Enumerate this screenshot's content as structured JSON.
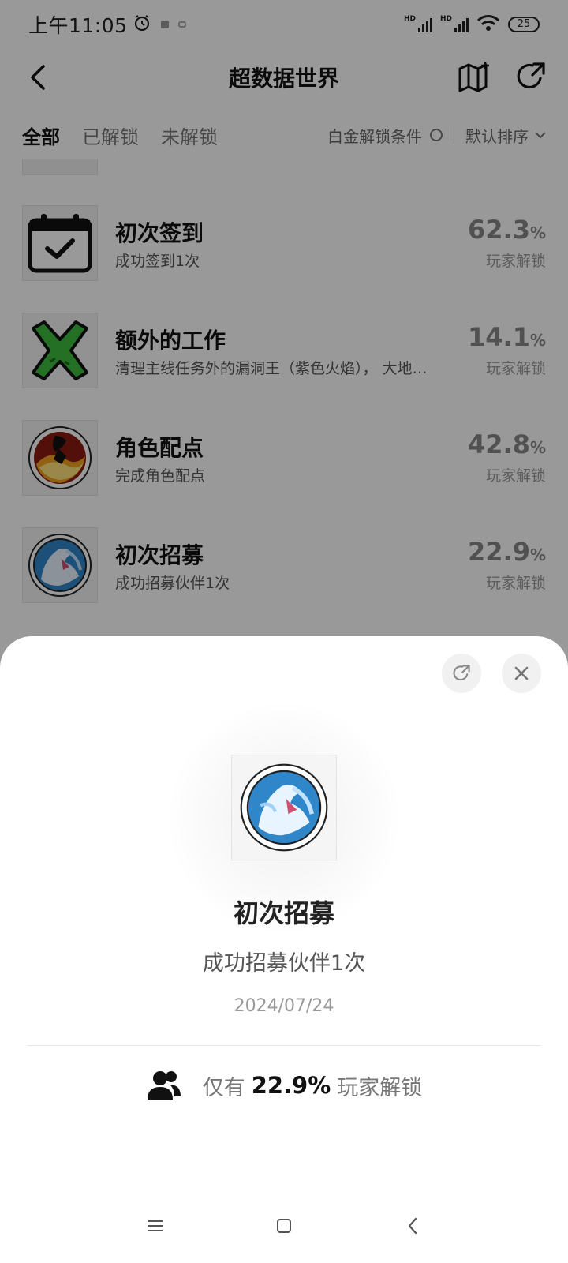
{
  "status_bar": {
    "time": "上午11:05",
    "battery": "25"
  },
  "nav": {
    "title": "超数据世界"
  },
  "filters": {
    "tabs": [
      "全部",
      "已解锁",
      "未解锁"
    ],
    "platinum_condition": "白金解锁条件",
    "sort": "默认排序"
  },
  "achievements": [
    {
      "title": "初次签到",
      "desc": "成功签到1次",
      "pct": "62.3",
      "unit": "%",
      "sub": "玩家解锁",
      "icon": "calendar-check-icon"
    },
    {
      "title": "额外的工作",
      "desc": "清理主线任务外的漏洞王（紫色火焰）， 大地…",
      "pct": "14.1",
      "unit": "%",
      "sub": "玩家解锁",
      "icon": "green-x-icon"
    },
    {
      "title": "角色配点",
      "desc": "完成角色配点",
      "pct": "42.8",
      "unit": "%",
      "sub": "玩家解锁",
      "icon": "flame-warrior-badge-icon"
    },
    {
      "title": "初次招募",
      "desc": "成功招募伙伴1次",
      "pct": "22.9",
      "unit": "%",
      "sub": "玩家解锁",
      "icon": "ice-wolf-badge-icon"
    }
  ],
  "sheet": {
    "title": "初次招募",
    "desc": "成功招募伙伴1次",
    "date": "2024/07/24",
    "stat_prefix": "仅有",
    "stat_value": "22.9%",
    "stat_suffix": "玩家解锁",
    "icon": "ice-wolf-badge-icon"
  },
  "colors": {
    "accent_green": "#3dbb3d",
    "dim_overlay": "rgba(0,0,0,0.40)"
  }
}
